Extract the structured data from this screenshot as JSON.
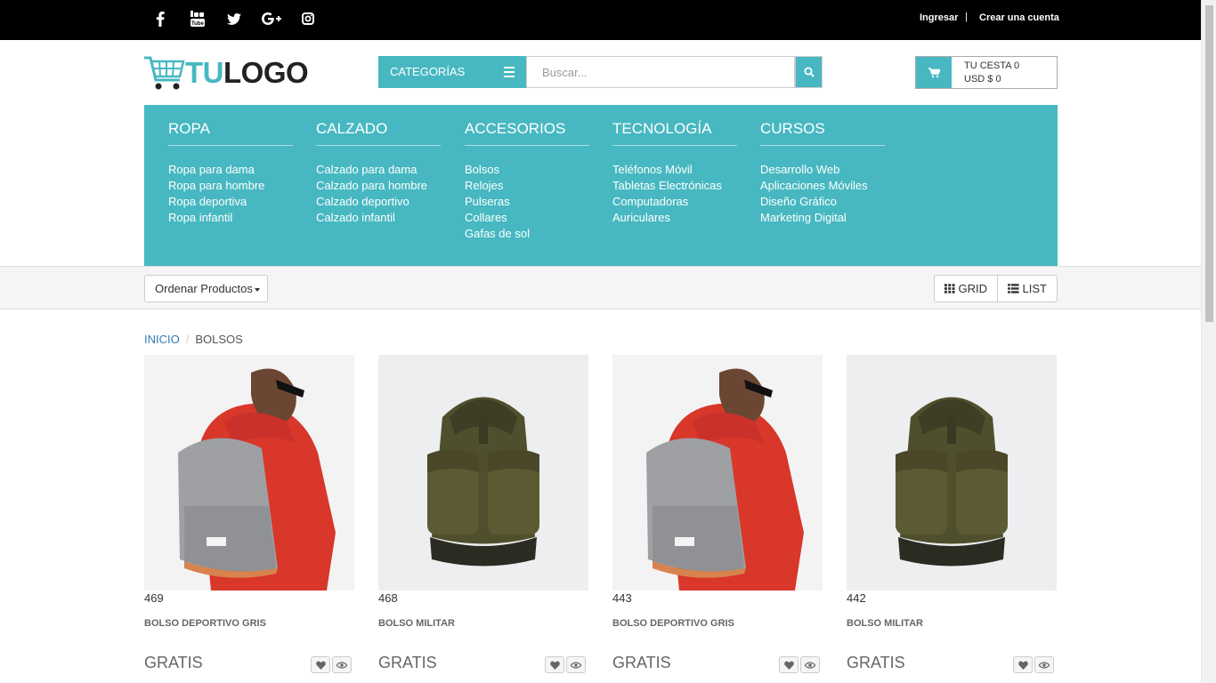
{
  "topbar": {
    "social_icons": [
      "facebook-icon",
      "youtube-icon",
      "twitter-icon",
      "google-plus-icon",
      "instagram-icon"
    ],
    "login": "Ingresar",
    "separator": "|",
    "register": "Crear una cuenta"
  },
  "header": {
    "logo_tu": "TU",
    "logo_logo": "LOGO",
    "categories_label": "CATEGORÍAS",
    "search_placeholder": "Buscar...",
    "cart_line1": "TU CESTA 0",
    "cart_line2": "USD $ 0"
  },
  "menu": [
    {
      "title": "ROPA",
      "items": [
        "Ropa para dama",
        "Ropa para hombre",
        "Ropa deportiva",
        "Ropa infantil"
      ]
    },
    {
      "title": "CALZADO",
      "items": [
        "Calzado para dama",
        "Calzado para hombre",
        "Calzado deportivo",
        "Calzado infantil"
      ]
    },
    {
      "title": "ACCESORIOS",
      "items": [
        "Bolsos",
        "Relojes",
        "Pulseras",
        "Collares",
        "Gafas de sol"
      ]
    },
    {
      "title": "TECNOLOGÍA",
      "items": [
        "Teléfonos Móvil",
        "Tabletas Electrónicas",
        "Computadoras",
        "Auriculares"
      ]
    },
    {
      "title": "CURSOS",
      "items": [
        "Desarrollo Web",
        "Aplicaciones Móviles",
        "Diseño Gráfico",
        "Marketing Digital"
      ]
    }
  ],
  "toolbar": {
    "sort_label": "Ordenar Productos",
    "grid_label": "GRID",
    "list_label": "LIST"
  },
  "breadcrumb": {
    "home": "INICIO",
    "separator": "/",
    "current": "BOLSOS"
  },
  "products": [
    {
      "id": "469",
      "name": "BOLSO DEPORTIVO GRIS",
      "price": "GRATIS",
      "image": "man-grey-backpack"
    },
    {
      "id": "468",
      "name": "BOLSO MILITAR",
      "price": "GRATIS",
      "image": "olive-backpack"
    },
    {
      "id": "443",
      "name": "BOLSO DEPORTIVO GRIS",
      "price": "GRATIS",
      "image": "man-grey-backpack"
    },
    {
      "id": "442",
      "name": "BOLSO MILITAR",
      "price": "GRATIS",
      "image": "olive-backpack"
    }
  ],
  "colors": {
    "accent": "#47b8c1",
    "topbar": "#000000",
    "link": "#337ab7"
  }
}
